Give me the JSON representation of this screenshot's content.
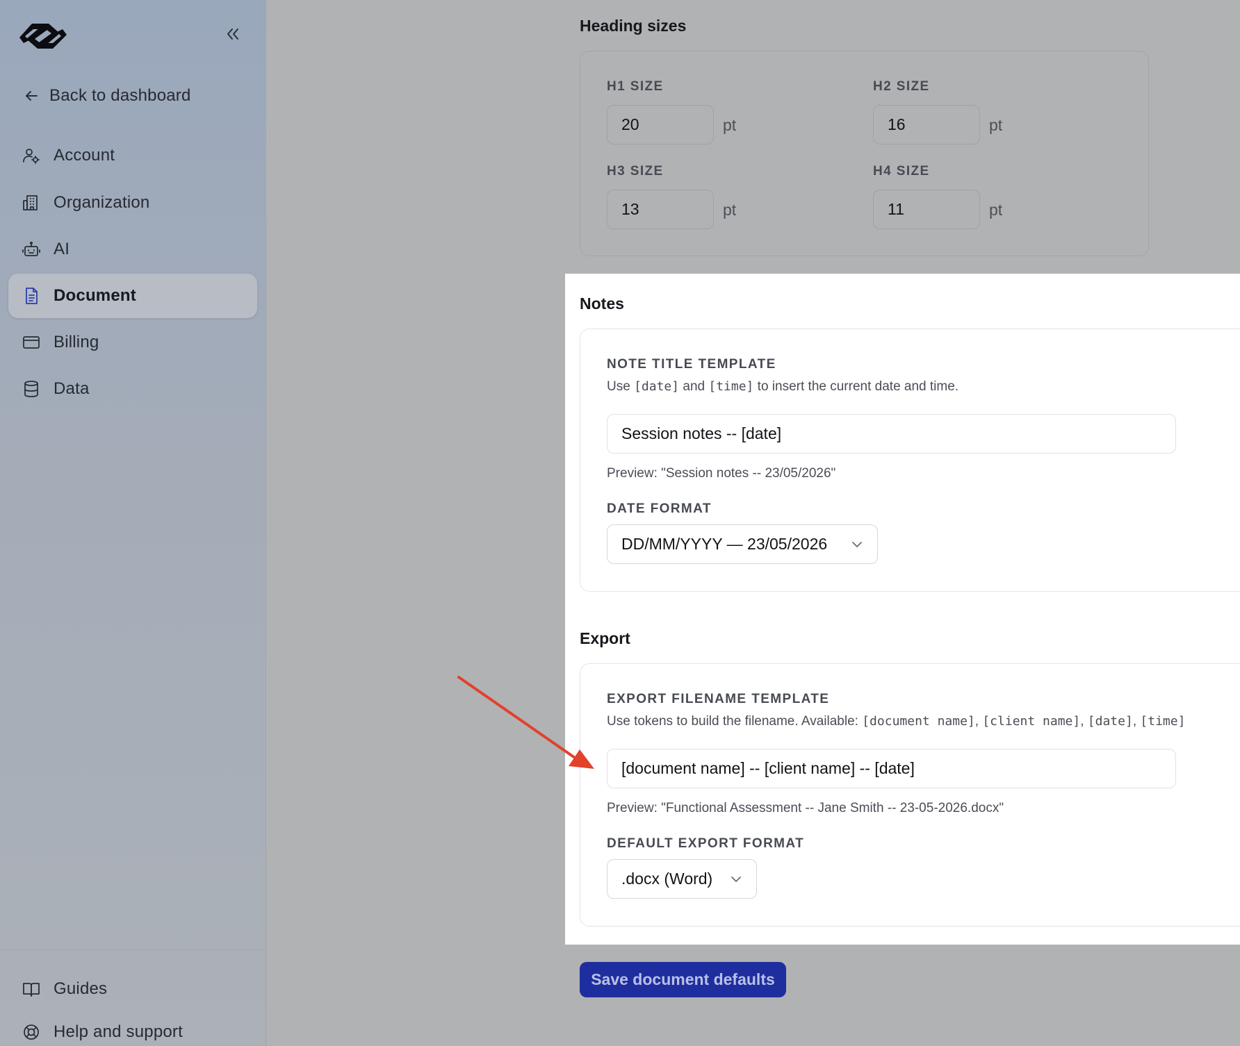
{
  "sidebar": {
    "back_label": "Back to dashboard",
    "items": [
      {
        "label": "Account",
        "icon": "user-gear-icon"
      },
      {
        "label": "Organization",
        "icon": "building-icon"
      },
      {
        "label": "AI",
        "icon": "robot-icon"
      },
      {
        "label": "Document",
        "icon": "document-icon",
        "active": true
      },
      {
        "label": "Billing",
        "icon": "credit-card-icon"
      },
      {
        "label": "Data",
        "icon": "database-icon"
      }
    ],
    "footer": [
      {
        "label": "Guides",
        "icon": "book-icon"
      },
      {
        "label": "Help and support",
        "icon": "lifebuoy-icon"
      }
    ]
  },
  "heading_sizes": {
    "title": "Heading sizes",
    "h1": {
      "label": "H1 SIZE",
      "value": "20",
      "unit": "pt"
    },
    "h2": {
      "label": "H2 SIZE",
      "value": "16",
      "unit": "pt"
    },
    "h3": {
      "label": "H3 SIZE",
      "value": "13",
      "unit": "pt"
    },
    "h4": {
      "label": "H4 SIZE",
      "value": "11",
      "unit": "pt"
    }
  },
  "notes": {
    "title": "Notes",
    "template_label": "NOTE TITLE TEMPLATE",
    "help_prefix": "Use ",
    "help_token1": "[date]",
    "help_mid": " and ",
    "help_token2": "[time]",
    "help_suffix": " to insert the current date and time.",
    "template_value": "Session notes -- [date]",
    "preview": "Preview: \"Session notes -- 23/05/2026\"",
    "date_format_label": "DATE FORMAT",
    "date_format_value": "DD/MM/YYYY — 23/05/2026"
  },
  "export": {
    "title": "Export",
    "filename_label": "EXPORT FILENAME TEMPLATE",
    "help_prefix": "Use tokens to build the filename. Available: ",
    "tokens": [
      "[document name]",
      "[client name]",
      "[date]",
      "[time]"
    ],
    "token_separator": ", ",
    "filename_value": "[document name] -- [client name] -- [date]",
    "preview": "Preview: \"Functional Assessment -- Jane Smith -- 23-05-2026.docx\"",
    "format_label": "DEFAULT EXPORT FORMAT",
    "format_value": ".docx (Word)"
  },
  "actions": {
    "save_label": "Save document defaults"
  },
  "colors": {
    "primary": "#1e2e9e",
    "annotation_arrow": "#e2412c"
  }
}
